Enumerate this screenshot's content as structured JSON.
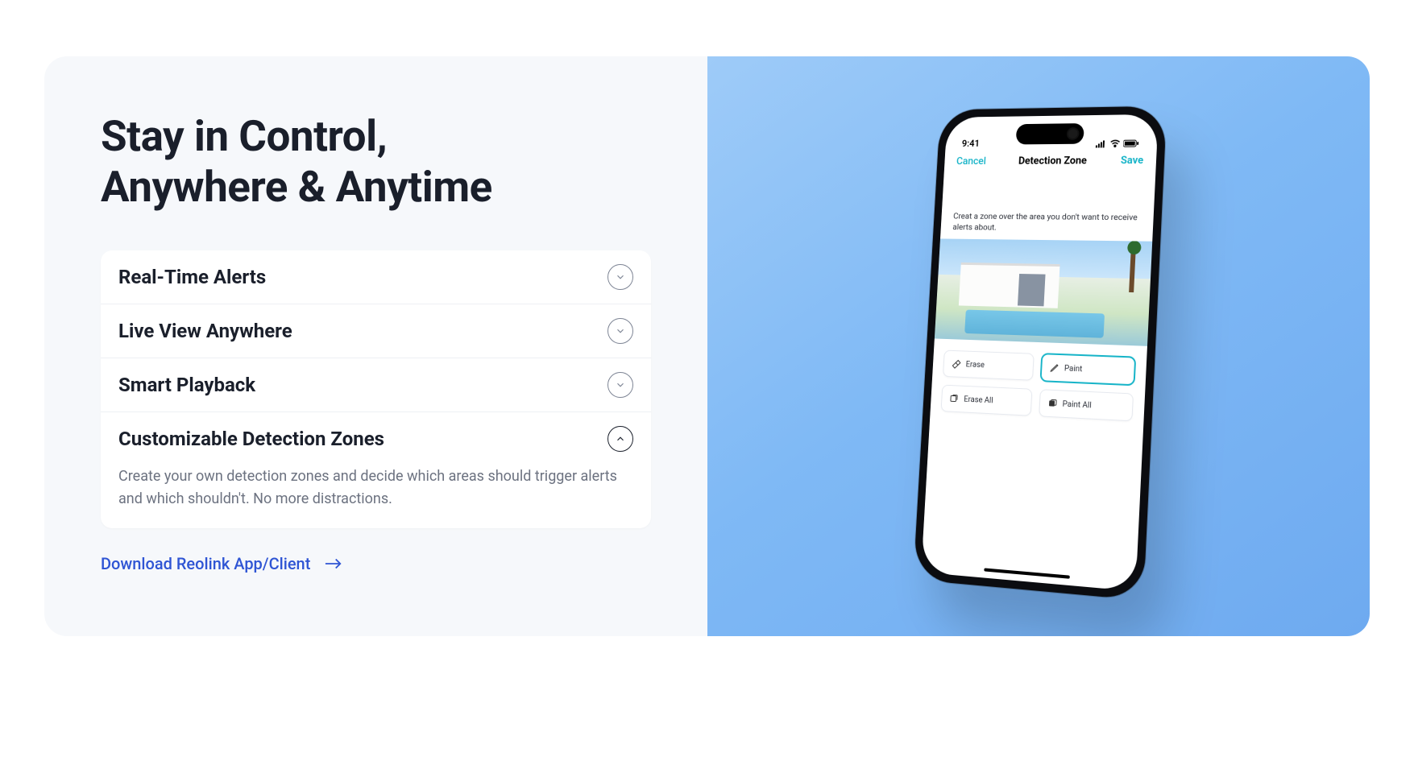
{
  "headline_line1": "Stay in Control,",
  "headline_line2": "Anywhere & Anytime",
  "accordion": [
    {
      "title": "Real-Time Alerts",
      "expanded": false
    },
    {
      "title": "Live View Anywhere",
      "expanded": false
    },
    {
      "title": "Smart Playback",
      "expanded": false
    },
    {
      "title": "Customizable Detection Zones",
      "expanded": true,
      "body": "Create your own detection zones and decide which areas should trigger alerts and which shouldn't. No more distractions."
    }
  ],
  "download_label": "Download Reolink App/Client",
  "phone": {
    "time": "9:41",
    "nav_cancel": "Cancel",
    "nav_title": "Detection Zone",
    "nav_save": "Save",
    "hint": "Creat a zone over the area you don't want to receive alerts about.",
    "tools": {
      "erase": "Erase",
      "paint": "Paint",
      "erase_all": "Erase All",
      "paint_all": "Paint All"
    }
  }
}
